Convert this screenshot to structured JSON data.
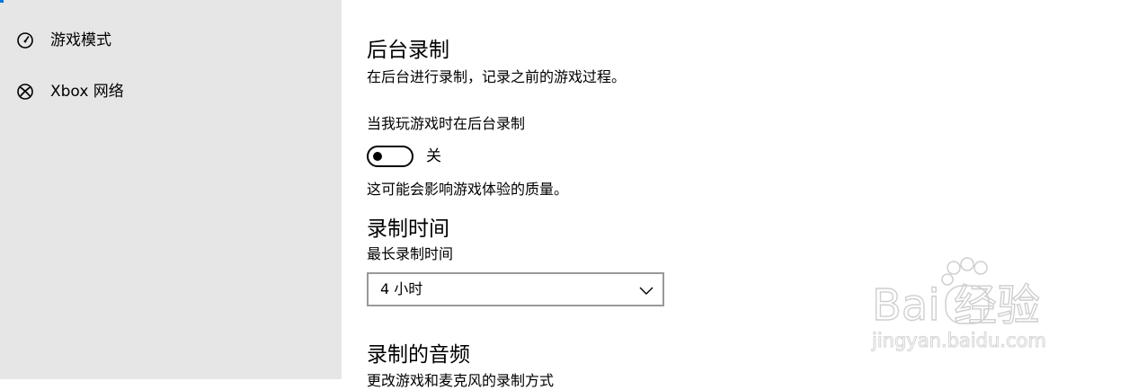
{
  "sidebar": {
    "items": [
      {
        "label": "游戏模式",
        "icon": "gauge-icon"
      },
      {
        "label": "Xbox 网络",
        "icon": "xbox-icon"
      }
    ]
  },
  "content": {
    "background_recording": {
      "title": "后台录制",
      "description": "在后台进行录制，记录之前的游戏过程。",
      "toggle_label": "当我玩游戏时在后台录制",
      "toggle_state": "关",
      "toggle_on": false,
      "note": "这可能会影响游戏体验的质量。"
    },
    "recording_time": {
      "title": "录制时间",
      "max_label": "最长录制时间",
      "selected": "4 小时"
    },
    "recorded_audio": {
      "title": "录制的音频",
      "description_partial": "更改游戏和麦克风的录制方式"
    }
  },
  "watermark": {
    "brand": "Bai 经验",
    "url": "jingyan.baidu.com"
  },
  "colors": {
    "sidebar_bg": "#e6e6e6",
    "accent": "#0078d7",
    "dropdown_border": "#999999"
  }
}
